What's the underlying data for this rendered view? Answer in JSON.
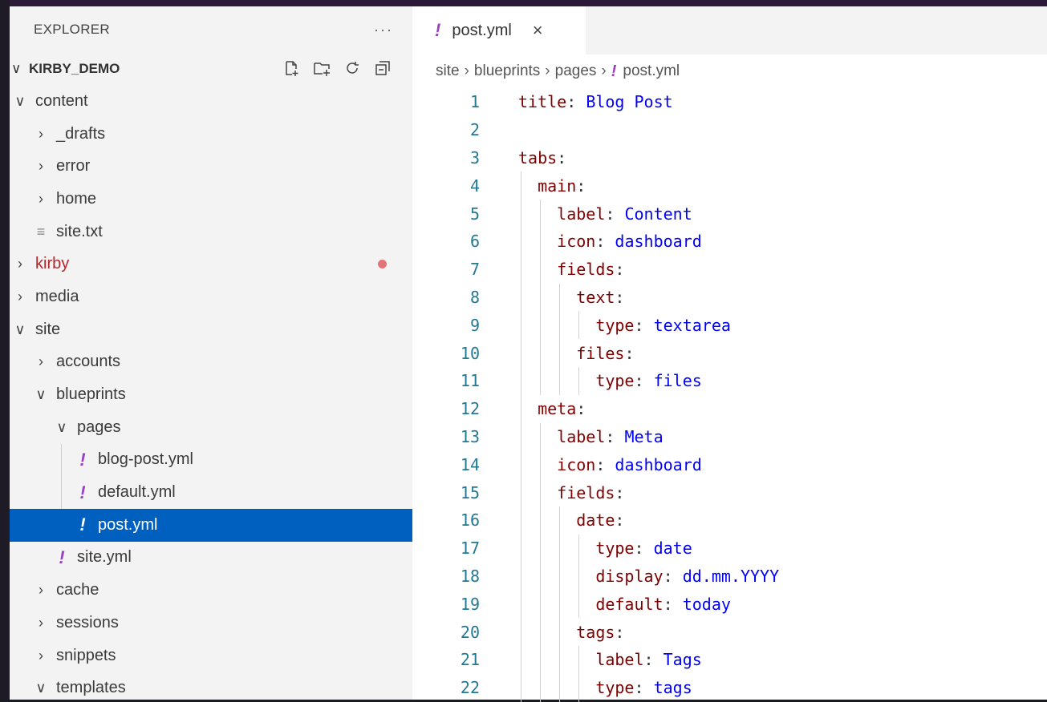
{
  "sidebar": {
    "title": "EXPLORER",
    "more": "···",
    "project": "KIRBY_DEMO",
    "tree": [
      {
        "label": "content",
        "depth": 0,
        "type": "folder",
        "open": true
      },
      {
        "label": "_drafts",
        "depth": 1,
        "type": "folder",
        "open": false
      },
      {
        "label": "error",
        "depth": 1,
        "type": "folder",
        "open": false
      },
      {
        "label": "home",
        "depth": 1,
        "type": "folder",
        "open": false
      },
      {
        "label": "site.txt",
        "depth": 1,
        "type": "txt"
      },
      {
        "label": "kirby",
        "depth": 0,
        "type": "folder",
        "open": false,
        "modified": true
      },
      {
        "label": "media",
        "depth": 0,
        "type": "folder",
        "open": false
      },
      {
        "label": "site",
        "depth": 0,
        "type": "folder",
        "open": true
      },
      {
        "label": "accounts",
        "depth": 1,
        "type": "folder",
        "open": false
      },
      {
        "label": "blueprints",
        "depth": 1,
        "type": "folder",
        "open": true
      },
      {
        "label": "pages",
        "depth": 2,
        "type": "folder",
        "open": true
      },
      {
        "label": "blog-post.yml",
        "depth": 3,
        "type": "yml"
      },
      {
        "label": "default.yml",
        "depth": 3,
        "type": "yml"
      },
      {
        "label": "post.yml",
        "depth": 3,
        "type": "yml",
        "selected": true
      },
      {
        "label": "site.yml",
        "depth": 2,
        "type": "yml"
      },
      {
        "label": "cache",
        "depth": 1,
        "type": "folder",
        "open": false
      },
      {
        "label": "sessions",
        "depth": 1,
        "type": "folder",
        "open": false
      },
      {
        "label": "snippets",
        "depth": 1,
        "type": "folder",
        "open": false
      },
      {
        "label": "templates",
        "depth": 1,
        "type": "folder",
        "open": true
      }
    ]
  },
  "editor": {
    "tab": {
      "label": "post.yml",
      "icon": "!",
      "close": "×"
    },
    "breadcrumb": [
      "site",
      "blueprints",
      "pages",
      "post.yml"
    ],
    "lines": [
      {
        "n": "1",
        "indent": 0,
        "key": "title",
        "value": "Blog Post"
      },
      {
        "n": "2",
        "indent": 0,
        "key": "",
        "value": ""
      },
      {
        "n": "3",
        "indent": 0,
        "key": "tabs",
        "value": ""
      },
      {
        "n": "4",
        "indent": 1,
        "key": "main",
        "value": ""
      },
      {
        "n": "5",
        "indent": 2,
        "key": "label",
        "value": "Content"
      },
      {
        "n": "6",
        "indent": 2,
        "key": "icon",
        "value": "dashboard"
      },
      {
        "n": "7",
        "indent": 2,
        "key": "fields",
        "value": ""
      },
      {
        "n": "8",
        "indent": 3,
        "key": "text",
        "value": ""
      },
      {
        "n": "9",
        "indent": 4,
        "key": "type",
        "value": "textarea"
      },
      {
        "n": "10",
        "indent": 3,
        "key": "files",
        "value": ""
      },
      {
        "n": "11",
        "indent": 4,
        "key": "type",
        "value": "files"
      },
      {
        "n": "12",
        "indent": 1,
        "key": "meta",
        "value": ""
      },
      {
        "n": "13",
        "indent": 2,
        "key": "label",
        "value": "Meta"
      },
      {
        "n": "14",
        "indent": 2,
        "key": "icon",
        "value": "dashboard"
      },
      {
        "n": "15",
        "indent": 2,
        "key": "fields",
        "value": ""
      },
      {
        "n": "16",
        "indent": 3,
        "key": "date",
        "value": ""
      },
      {
        "n": "17",
        "indent": 4,
        "key": "type",
        "value": "date"
      },
      {
        "n": "18",
        "indent": 4,
        "key": "display",
        "value": "dd.mm.YYYY"
      },
      {
        "n": "19",
        "indent": 4,
        "key": "default",
        "value": "today"
      },
      {
        "n": "20",
        "indent": 3,
        "key": "tags",
        "value": ""
      },
      {
        "n": "21",
        "indent": 4,
        "key": "label",
        "value": "Tags"
      },
      {
        "n": "22",
        "indent": 4,
        "key": "type",
        "value": "tags"
      }
    ]
  },
  "colors": {
    "selection": "#0060c0",
    "yaml_key": "#800000",
    "yaml_value": "#0000ff",
    "line_number": "#237893",
    "modified_dot": "#e27575"
  }
}
